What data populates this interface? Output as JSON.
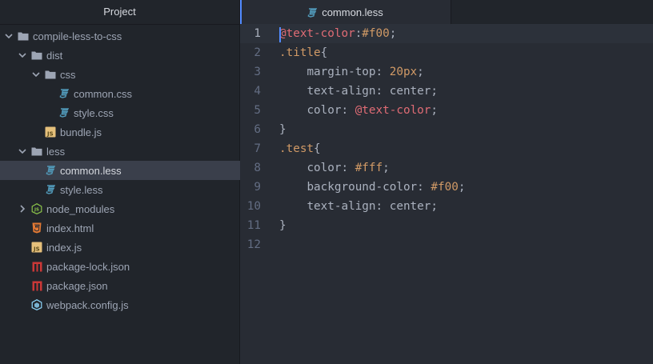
{
  "sidebar": {
    "title": "Project",
    "items": [
      {
        "label": "compile-less-to-css",
        "kind": "folder",
        "expanded": true,
        "depth": 0,
        "icon": "folder-icon"
      },
      {
        "label": "dist",
        "kind": "folder",
        "expanded": true,
        "depth": 1,
        "icon": "folder-icon"
      },
      {
        "label": "css",
        "kind": "folder",
        "expanded": true,
        "depth": 2,
        "icon": "folder-icon"
      },
      {
        "label": "common.css",
        "kind": "file",
        "depth": 3,
        "icon": "css3-icon"
      },
      {
        "label": "style.css",
        "kind": "file",
        "depth": 3,
        "icon": "css3-icon"
      },
      {
        "label": "bundle.js",
        "kind": "file",
        "depth": 2,
        "icon": "js-icon"
      },
      {
        "label": "less",
        "kind": "folder",
        "expanded": true,
        "depth": 1,
        "icon": "folder-icon"
      },
      {
        "label": "common.less",
        "kind": "file",
        "depth": 2,
        "icon": "css3-icon",
        "selected": true
      },
      {
        "label": "style.less",
        "kind": "file",
        "depth": 2,
        "icon": "css3-icon"
      },
      {
        "label": "node_modules",
        "kind": "folder",
        "expanded": false,
        "depth": 1,
        "icon": "nodejs-icon"
      },
      {
        "label": "index.html",
        "kind": "file",
        "depth": 1,
        "icon": "html5-icon"
      },
      {
        "label": "index.js",
        "kind": "file",
        "depth": 1,
        "icon": "js-icon"
      },
      {
        "label": "package-lock.json",
        "kind": "file",
        "depth": 1,
        "icon": "npm-icon"
      },
      {
        "label": "package.json",
        "kind": "file",
        "depth": 1,
        "icon": "npm-icon"
      },
      {
        "label": "webpack.config.js",
        "kind": "file",
        "depth": 1,
        "icon": "webpack-icon"
      }
    ]
  },
  "editor": {
    "tab_label": "common.less",
    "tab_icon": "css3-icon",
    "lines": [
      {
        "n": "1",
        "tokens": [
          [
            "var",
            "@text-color"
          ],
          [
            "punc",
            ":"
          ],
          [
            "hex",
            "#f00"
          ],
          [
            "punc",
            ";"
          ]
        ]
      },
      {
        "n": "2",
        "tokens": [
          [
            "sel",
            ".title"
          ],
          [
            "punc",
            "{"
          ]
        ]
      },
      {
        "n": "3",
        "tokens": [
          [
            "punc",
            "    "
          ],
          [
            "prop",
            "margin-top"
          ],
          [
            "punc",
            ": "
          ],
          [
            "num",
            "20px"
          ],
          [
            "punc",
            ";"
          ]
        ]
      },
      {
        "n": "4",
        "tokens": [
          [
            "punc",
            "    "
          ],
          [
            "prop",
            "text-align"
          ],
          [
            "punc",
            ": center;"
          ]
        ]
      },
      {
        "n": "5",
        "tokens": [
          [
            "punc",
            "    "
          ],
          [
            "prop",
            "color"
          ],
          [
            "punc",
            ": "
          ],
          [
            "var",
            "@text-color"
          ],
          [
            "punc",
            ";"
          ]
        ]
      },
      {
        "n": "6",
        "tokens": [
          [
            "punc",
            "}"
          ]
        ]
      },
      {
        "n": "7",
        "tokens": [
          [
            "sel",
            ".test"
          ],
          [
            "punc",
            "{"
          ]
        ]
      },
      {
        "n": "8",
        "tokens": [
          [
            "punc",
            "    "
          ],
          [
            "prop",
            "color"
          ],
          [
            "punc",
            ": "
          ],
          [
            "hex",
            "#fff"
          ],
          [
            "punc",
            ";"
          ]
        ]
      },
      {
        "n": "9",
        "tokens": [
          [
            "punc",
            "    "
          ],
          [
            "prop",
            "background-color"
          ],
          [
            "punc",
            ": "
          ],
          [
            "hex",
            "#f00"
          ],
          [
            "punc",
            ";"
          ]
        ]
      },
      {
        "n": "10",
        "tokens": [
          [
            "punc",
            "    "
          ],
          [
            "prop",
            "text-align"
          ],
          [
            "punc",
            ": center;"
          ]
        ]
      },
      {
        "n": "11",
        "tokens": [
          [
            "punc",
            "}"
          ]
        ]
      },
      {
        "n": "12",
        "tokens": []
      }
    ],
    "cursor_line": "1"
  },
  "colors": {
    "accent": "#528bff",
    "css3": "#519aba",
    "js": "#e5c07b",
    "html5": "#e37933",
    "npm": "#cb3837",
    "nodejs": "#8bc34a",
    "webpack": "#8ed6fb"
  }
}
